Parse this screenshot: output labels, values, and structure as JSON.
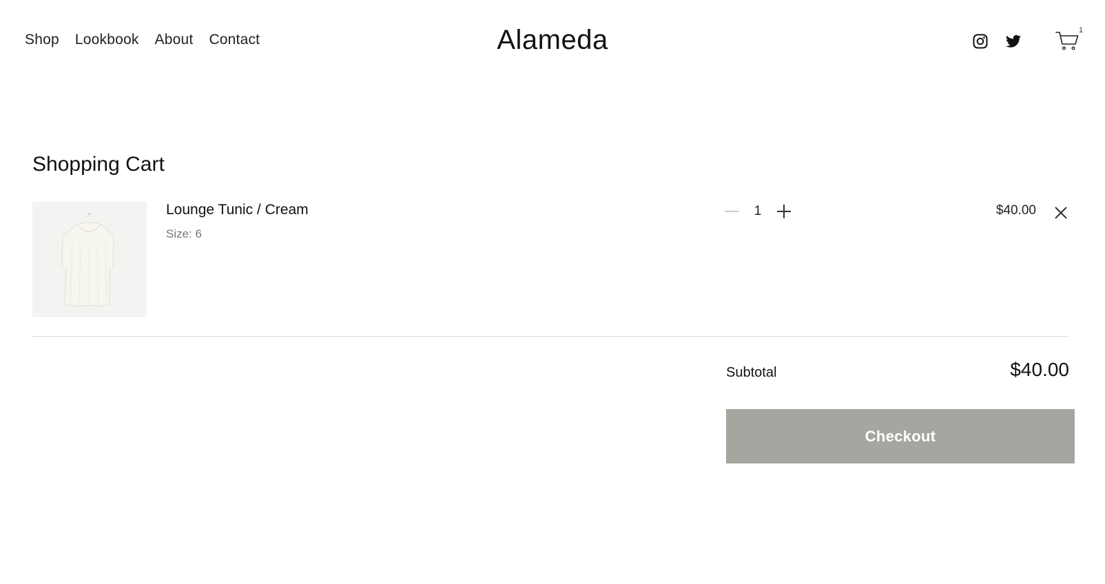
{
  "header": {
    "nav": [
      {
        "label": "Shop"
      },
      {
        "label": "Lookbook"
      },
      {
        "label": "About"
      },
      {
        "label": "Contact"
      }
    ],
    "logo": "Alameda",
    "social": [
      {
        "icon": "instagram-icon"
      },
      {
        "icon": "twitter-icon"
      }
    ],
    "cart_icon": "cart-icon",
    "cart_count": "1"
  },
  "cart": {
    "title": "Shopping Cart",
    "items": [
      {
        "name": "Lounge Tunic / Cream",
        "size_label": "Size:",
        "size_value": "6",
        "quantity": "1",
        "price": "$40.00",
        "decrement_icon": "minus-icon",
        "increment_icon": "plus-icon",
        "remove_icon": "close-icon"
      }
    ],
    "subtotal_label": "Subtotal",
    "subtotal_value": "$40.00",
    "checkout_label": "Checkout"
  },
  "colors": {
    "checkout_bg": "#a6a5a0",
    "text": "#111111",
    "muted": "#777777",
    "divider": "#dcdcdc"
  }
}
